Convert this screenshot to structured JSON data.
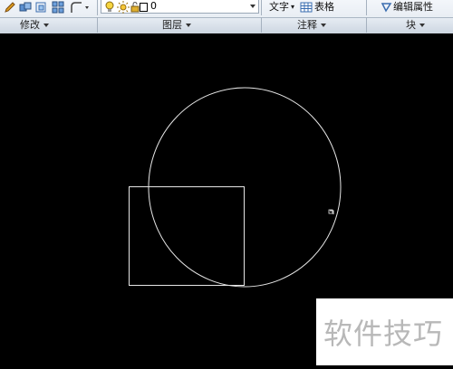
{
  "toolbar": {
    "layer_name": "0",
    "text_label": "文字",
    "table_label": "表格",
    "edit_attr_label": "编辑属性"
  },
  "panels": {
    "modify": "修改",
    "layers": "图层",
    "annotate": "注释",
    "block": "块"
  },
  "watermark": "软件技巧",
  "colors": {
    "canvas_bg": "#000000",
    "drawing_stroke": "#e6e6e6",
    "ribbon_bg": "#e4eaf1"
  }
}
